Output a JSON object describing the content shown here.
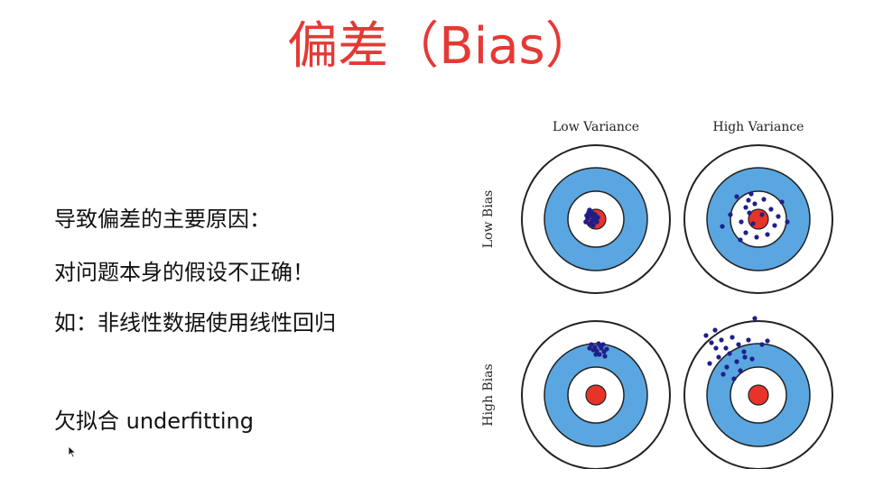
{
  "title": "偏差（Bias）",
  "bullets": {
    "line1": "导致偏差的主要原因：",
    "line2": "对问题本身的假设不正确！",
    "line3": "如：非线性数据使用线性回归",
    "line4": "欠拟合 underfitting"
  },
  "diagram": {
    "col_labels": [
      "Low Variance",
      "High Variance"
    ],
    "row_labels": [
      "Low Bias",
      "High Bias"
    ]
  },
  "colors": {
    "title": "#e53935",
    "ring_blue": "#5aa6e0",
    "bullseye": "#e8332a",
    "points": "#1f1f8a"
  }
}
